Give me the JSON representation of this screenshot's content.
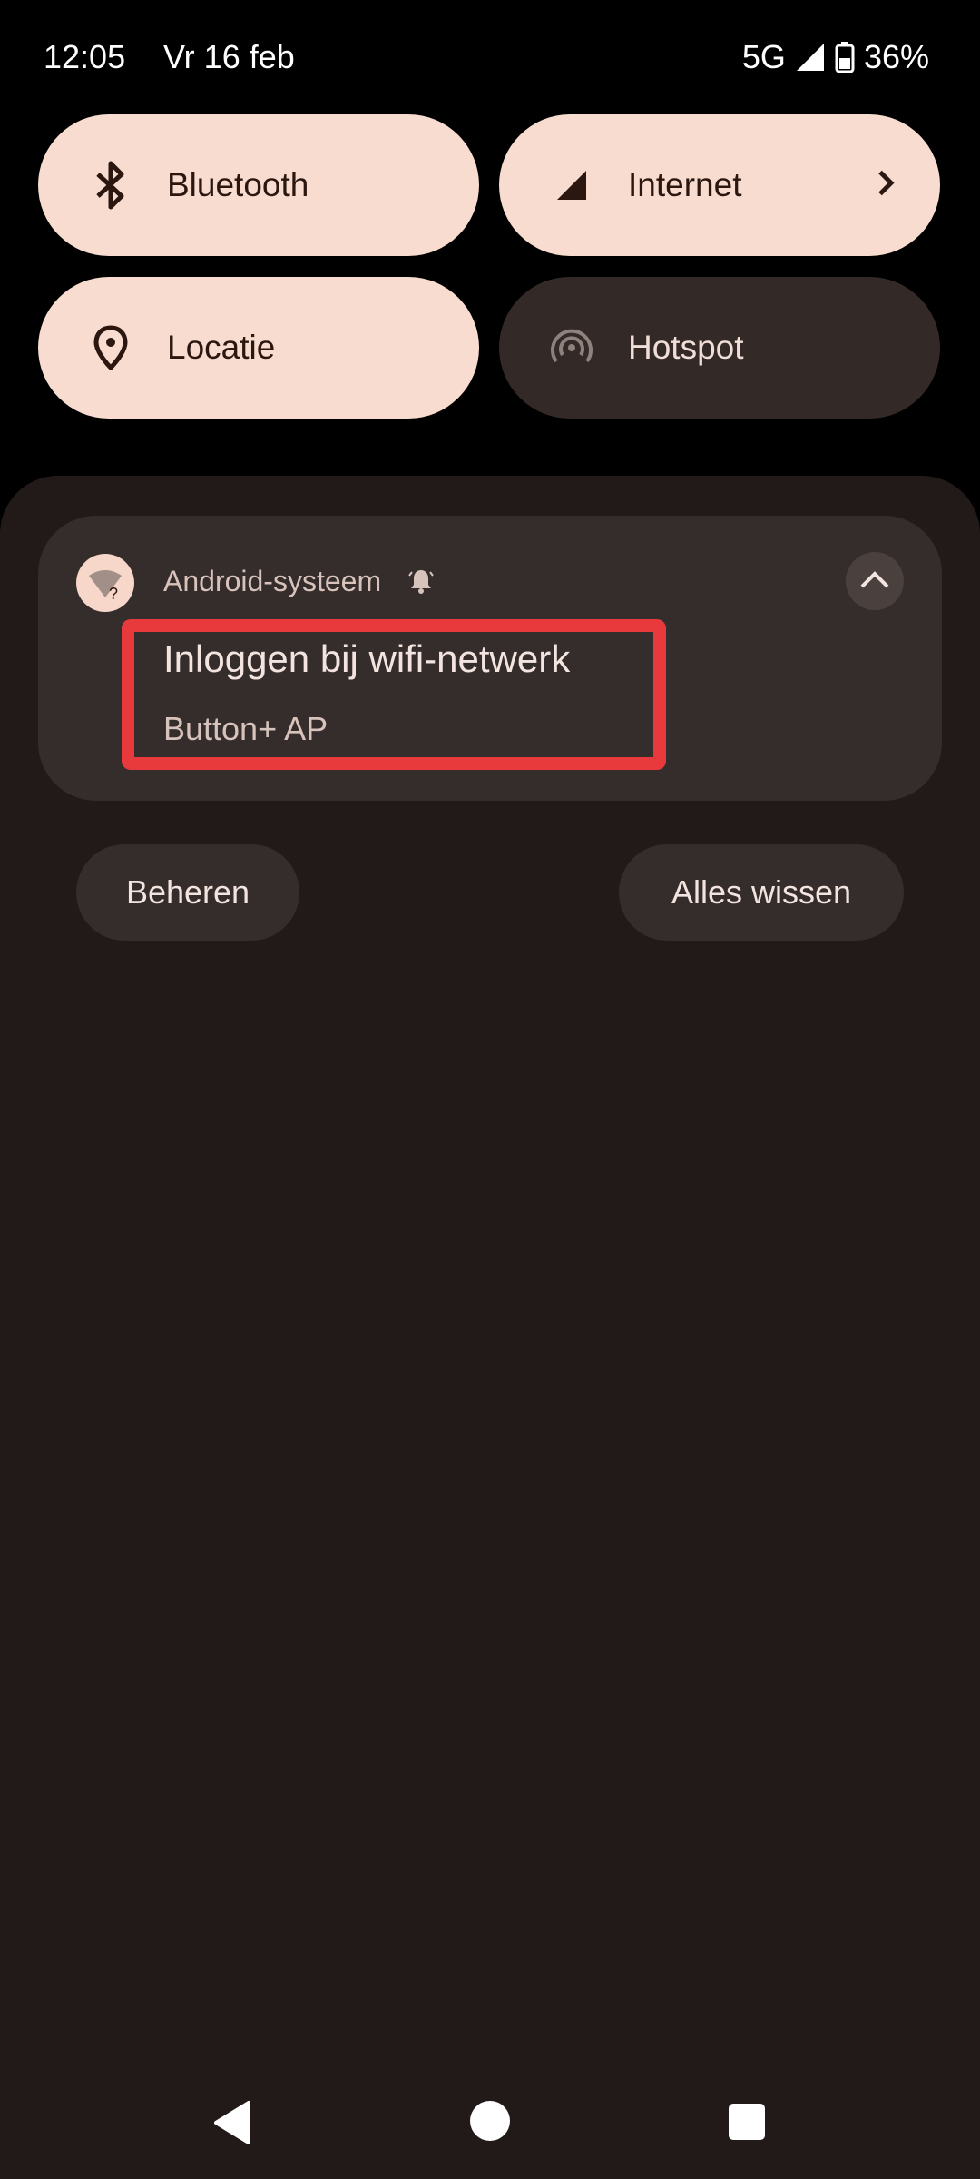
{
  "status_bar": {
    "time": "12:05",
    "date": "Vr 16 feb",
    "network": "5G",
    "battery": "36%"
  },
  "quick_tiles": [
    {
      "label": "Bluetooth",
      "icon": "bluetooth-icon",
      "active": true
    },
    {
      "label": "Internet",
      "icon": "cellular-signal-icon",
      "active": true,
      "has_chevron": true
    },
    {
      "label": "Locatie",
      "icon": "location-pin-icon",
      "active": true
    },
    {
      "label": "Hotspot",
      "icon": "hotspot-icon",
      "active": false
    }
  ],
  "notification": {
    "app_name": "Android-systeem",
    "title": "Inloggen bij wifi-netwerk",
    "text": "Button+ AP",
    "app_icon": "wifi-question-icon"
  },
  "actions": {
    "manage_label": "Beheren",
    "clear_all_label": "Alles wissen"
  },
  "colors": {
    "tile_active": "#f8dccf",
    "tile_inactive": "#332a27",
    "shade_bg": "#221a18",
    "card_bg": "#352d2b",
    "highlight": "#e8393d"
  }
}
